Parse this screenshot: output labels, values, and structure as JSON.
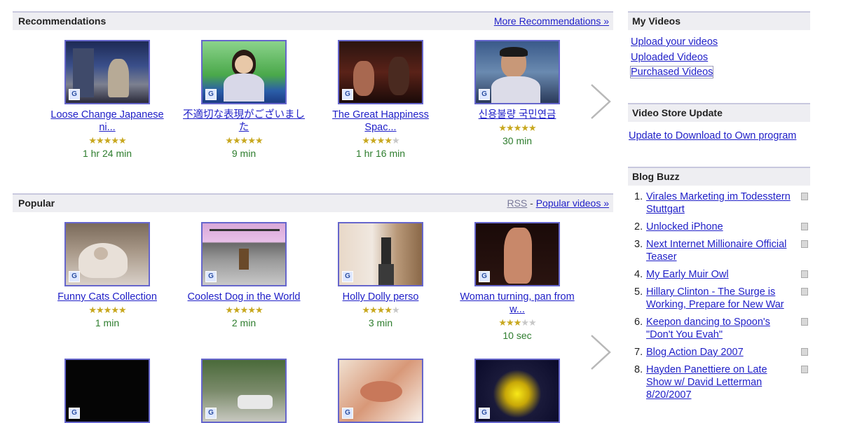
{
  "recommendations": {
    "title": "Recommendations",
    "more_link": "More Recommendations »",
    "videos": [
      {
        "title": "Loose Change Japanese ni...",
        "stars": 5,
        "duration": "1 hr 24 min"
      },
      {
        "title": "不適切な表現がございました",
        "stars": 5,
        "duration": "9 min"
      },
      {
        "title": "The Great Happiness Spac...",
        "stars": 4,
        "duration": "1 hr 16 min"
      },
      {
        "title": "신용불량 국민연금",
        "stars": 5,
        "duration": "30 min"
      }
    ]
  },
  "popular": {
    "title": "Popular",
    "rss_label": "RSS",
    "separator": "-",
    "popular_link": "Popular videos »",
    "videos": [
      {
        "title": "Funny Cats Collection",
        "stars": 5,
        "duration": "1 min"
      },
      {
        "title": "Coolest Dog in the World",
        "stars": 5,
        "duration": "2 min"
      },
      {
        "title": "Holly Dolly perso",
        "stars": 4,
        "duration": "3 min"
      },
      {
        "title": "Woman turning, pan from w...",
        "stars": 3,
        "duration": "10 sec"
      }
    ]
  },
  "sidebar": {
    "my_videos": {
      "title": "My Videos",
      "links": [
        "Upload your videos",
        "Uploaded Videos",
        "Purchased Videos"
      ]
    },
    "store_update": {
      "title": "Video Store Update",
      "link": "Update to Download to Own program"
    },
    "blog_buzz": {
      "title": "Blog Buzz",
      "items": [
        {
          "num": "1.",
          "text": "Virales Marketing im Todesstern Stuttgart"
        },
        {
          "num": "2.",
          "text": "Unlocked iPhone"
        },
        {
          "num": "3.",
          "text": "Next Internet Millionaire Official Teaser"
        },
        {
          "num": "4.",
          "text": "My Early Muir Owl"
        },
        {
          "num": "5.",
          "text": "Hillary Clinton - The Surge is Working, Prepare for New War"
        },
        {
          "num": "6.",
          "text": "Keepon dancing to Spoon's \"Don't You Evah\""
        },
        {
          "num": "7.",
          "text": "Blog Action Day 2007"
        },
        {
          "num": "8.",
          "text": "Hayden Panettiere on Late Show w/ David Letterman 8/20/2007"
        }
      ]
    }
  },
  "colors": {
    "link": "#2020c8",
    "duration": "#2e7d2e",
    "star_on": "#c8a820",
    "star_off": "#c8c8c8",
    "thumb_border": "#6666cc"
  },
  "icons": {
    "next": "chevron-right-icon",
    "badge": "video-badge-icon",
    "blog": "blog-entry-icon"
  }
}
